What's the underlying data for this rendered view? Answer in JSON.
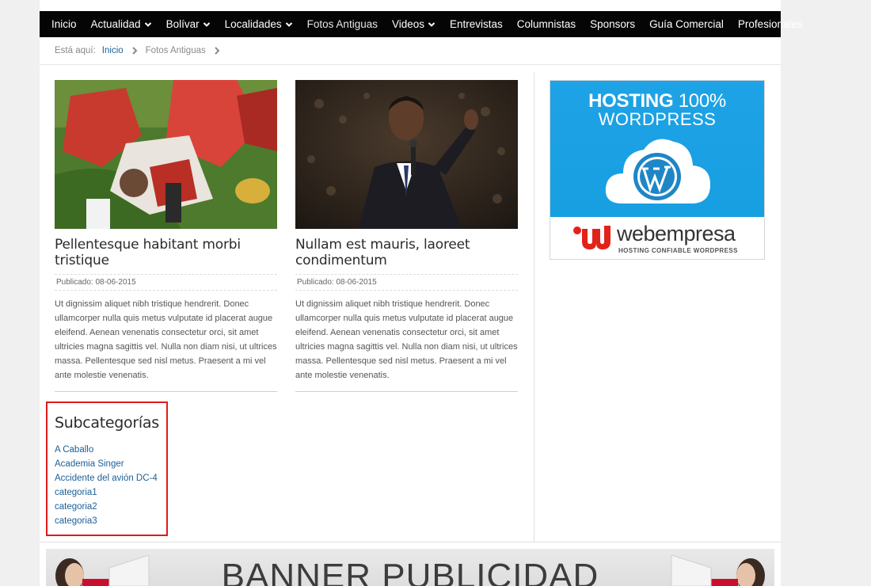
{
  "nav": {
    "items": [
      {
        "label": "Inicio",
        "dropdown": false
      },
      {
        "label": "Actualidad",
        "dropdown": true
      },
      {
        "label": "Bolívar",
        "dropdown": true
      },
      {
        "label": "Localidades",
        "dropdown": true
      },
      {
        "label": "Fotos Antiguas",
        "dropdown": false,
        "active": true
      },
      {
        "label": "Videos",
        "dropdown": true
      },
      {
        "label": "Entrevistas",
        "dropdown": false
      },
      {
        "label": "Columnistas",
        "dropdown": false
      },
      {
        "label": "Sponsors",
        "dropdown": false
      },
      {
        "label": "Guía Comercial",
        "dropdown": false
      },
      {
        "label": "Profesionales",
        "dropdown": false
      }
    ]
  },
  "breadcrumb": {
    "lead": "Está aquí:",
    "home": "Inicio",
    "current": "Fotos Antiguas"
  },
  "articles": [
    {
      "title": "Pellentesque habitant morbi tristique",
      "meta": "Publicado: 08-06-2015",
      "body": "Ut dignissim aliquet nibh tristique hendrerit. Donec ullamcorper nulla quis metus vulputate id placerat augue eleifend. Aenean venenatis consectetur orci, sit amet ultricies magna sagittis vel. Nulla non diam nisi, ut ultrices massa. Pellentesque sed nisl metus. Praesent a mi vel ante molestie venenatis."
    },
    {
      "title": "Nullam est mauris, laoreet condimentum",
      "meta": "Publicado: 08-06-2015",
      "body": "Ut dignissim aliquet nibh tristique hendrerit. Donec ullamcorper nulla quis metus vulputate id placerat augue eleifend. Aenean venenatis consectetur orci, sit amet ultricies magna sagittis vel. Nulla non diam nisi, ut ultrices massa. Pellentesque sed nisl metus. Praesent a mi vel ante molestie venenatis."
    }
  ],
  "subcategories": {
    "title": "Subcategorías",
    "items": [
      "A Caballo",
      "Academia Singer",
      "Accidente del avión DC-4",
      "categoria1",
      "categoria2",
      "categoria3"
    ]
  },
  "ad": {
    "line1_bold": "HOSTING",
    "line1_thin": "100%",
    "line2": "WORDPRESS",
    "brand": "webempresa",
    "tagline": "HOSTING CONFIABLE WORDPRESS"
  },
  "banner": {
    "text": "BANNER PUBLICIDAD"
  },
  "colors": {
    "nav_bg": "#050505",
    "link": "#1c5f96",
    "highlight_border": "#e01b1b",
    "ad_blue": "#1fa2e6",
    "brand_red": "#e2231a"
  }
}
